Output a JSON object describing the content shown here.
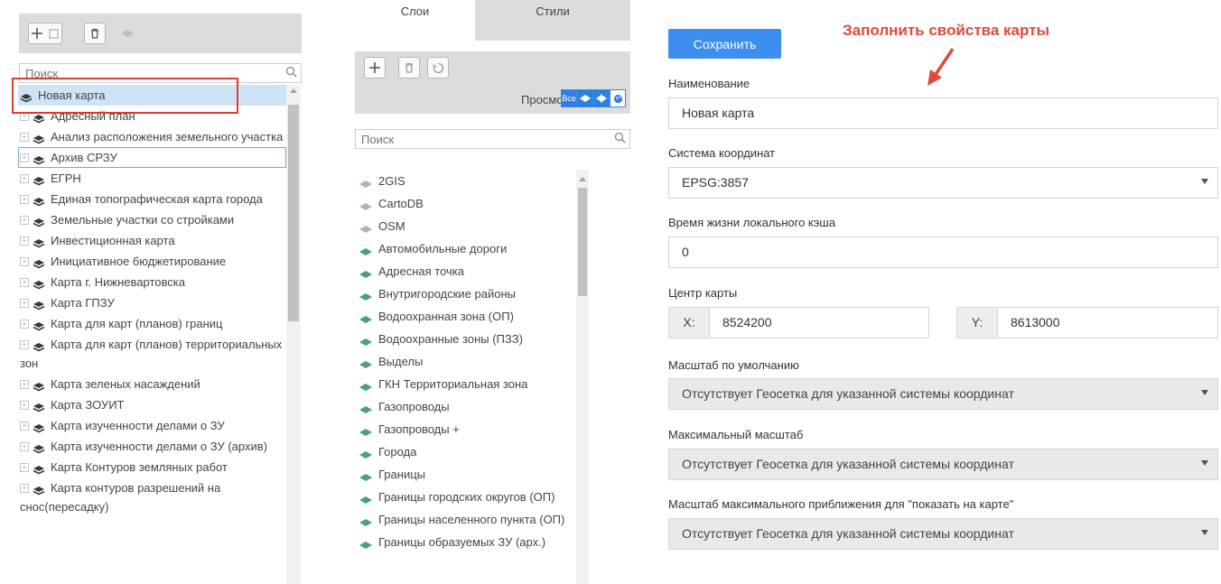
{
  "colors": {
    "accent": "#3e8ef0",
    "highlight_box": "#e03a30",
    "annotation": "#e04a3a",
    "selected_row": "#cfe3f7"
  },
  "left_panel": {
    "search_placeholder": "Поиск",
    "tree": [
      {
        "label": "Новая карта",
        "selected": true,
        "expander": false
      },
      {
        "label": "Адресный план",
        "expander": true
      },
      {
        "label": "Анализ расположения земельного участка",
        "expander": true
      },
      {
        "label": "Архив СРЗУ",
        "expander": true,
        "focused": true
      },
      {
        "label": "ЕГРН",
        "expander": true
      },
      {
        "label": "Единая топографическая карта города",
        "expander": true
      },
      {
        "label": "Земельные участки со стройками",
        "expander": true
      },
      {
        "label": "Инвестиционная карта",
        "expander": true
      },
      {
        "label": "Инициативное бюджетирование",
        "expander": true
      },
      {
        "label": "Карта г. Нижневартовска",
        "expander": true
      },
      {
        "label": "Карта ГПЗУ",
        "expander": true
      },
      {
        "label": "Карта для карт (планов) границ",
        "expander": true
      },
      {
        "label": "Карта для карт (планов) территориальных зон",
        "expander": true
      },
      {
        "label": "Карта зеленых насаждений",
        "expander": true
      },
      {
        "label": "Карта ЗОУИТ",
        "expander": true
      },
      {
        "label": "Карта изученности делами о ЗУ",
        "expander": true
      },
      {
        "label": "Карта изученности делами о ЗУ (архив)",
        "expander": true
      },
      {
        "label": "Карта Контуров земляных работ",
        "expander": true
      },
      {
        "label": "Карта контуров разрешений на снос(пересадку)",
        "expander": true
      }
    ]
  },
  "middle_panel": {
    "tabs": [
      "Слои",
      "Стили"
    ],
    "view_label": "Просмотр:",
    "view_buttons": [
      "Все",
      "diamond-icon",
      "diamond-cross-icon",
      "globe-icon"
    ],
    "search_placeholder": "Поиск",
    "layers": [
      {
        "label": "2GIS",
        "base": true
      },
      {
        "label": "CartoDB",
        "base": true
      },
      {
        "label": "OSM",
        "base": true
      },
      {
        "label": "Автомобильные дороги"
      },
      {
        "label": "Адресная точка"
      },
      {
        "label": "Внутригородские районы"
      },
      {
        "label": "Водоохранная зона (ОП)"
      },
      {
        "label": "Водоохранные зоны (ПЗЗ)"
      },
      {
        "label": "Выделы"
      },
      {
        "label": "ГКН Территориальная зона"
      },
      {
        "label": "Газопроводы"
      },
      {
        "label": "Газопроводы +"
      },
      {
        "label": "Города"
      },
      {
        "label": "Границы"
      },
      {
        "label": "Границы городских округов (ОП)"
      },
      {
        "label": "Границы населенного пункта (ОП)"
      },
      {
        "label": "Границы образуемых ЗУ (арх.)"
      }
    ]
  },
  "right_panel": {
    "save_label": "Сохранить",
    "annotation": "Заполнить свойства карты",
    "name_label": "Наименование",
    "name_value": "Новая карта",
    "crs_label": "Система координат",
    "crs_value": "EPSG:3857",
    "cache_label": "Время жизни локального кэша",
    "cache_value": "0",
    "center_label": "Центр карты",
    "x_label": "X:",
    "x_value": "8524200",
    "y_label": "Y:",
    "y_value": "8613000",
    "default_scale_label": "Масштаб по умолчанию",
    "default_scale_value": "Отсутствует Геосетка для указанной системы координат",
    "max_scale_label": "Максимальный масштаб",
    "max_scale_value": "Отсутствует Геосетка для указанной системы координат",
    "max_zoom_label": "Масштаб максимального приближения для \"показать на карте\"",
    "max_zoom_value": "Отсутствует Геосетка для указанной системы координат"
  }
}
